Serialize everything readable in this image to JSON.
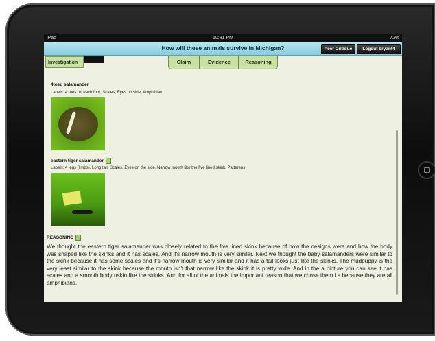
{
  "status_bar": {
    "carrier": "iPad",
    "time": "10:31 PM",
    "battery": "72%"
  },
  "header": {
    "title": "How will these animals survive in Michigan?",
    "peer_critique_label": "Peer Critique",
    "logout_label": "Logout bryant4"
  },
  "nav": {
    "investigation_tab": "Investigation",
    "tabs": [
      {
        "label": "Claim"
      },
      {
        "label": "Evidence"
      },
      {
        "label": "Reasoning"
      }
    ]
  },
  "evidence": [
    {
      "name": "4toed salamander",
      "labels": "Labels: 4 toes on each foot, Scales, Eyes on side, Amphibian"
    },
    {
      "name": "eastern tiger salamander",
      "labels": "Labels: 4 legs (limbs), Long tail, Scales, Eyes on the side, Narrow mouth like the five lined skink, Patterens"
    }
  ],
  "reasoning": {
    "heading": "REASONING",
    "text": "We thought the eastern tiger salamander was closely related to the five lined skink because of how the designs were and how the body was shaped like the skinks and it has scales. And it's narrow mouth is very similar. Next we thought the baby salamanders were similar to the skink because it has some scales and it's narrow mouth is very similar and it has a tail looks just like the skinks. The mudpuppy is the very least similar to the skink because the mouth isn't that narrow like the skink it is pretty wide. And in the a picture you can see it has scales and a smooth body nskin like the skinks. And for all of the animals the important reason that we chose them i s because they are all amphibians."
  },
  "colors": {
    "title_bar": "#9fd9e8",
    "tab": "#c8e0a4",
    "background": "#eef0e2"
  }
}
